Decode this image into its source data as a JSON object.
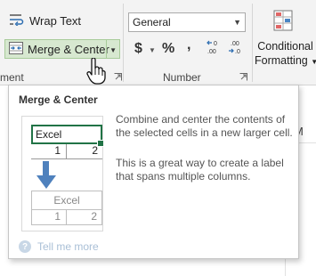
{
  "ribbon": {
    "alignment": {
      "group_label_partial": "ment",
      "wrap_text_label": "Wrap Text",
      "merge_center_label": "Merge & Center"
    },
    "number": {
      "group_label": "Number",
      "format_value": "General",
      "currency_symbol": "$",
      "percent_symbol": "%",
      "comma_symbol": ","
    },
    "styles": {
      "conditional_label_line1": "Conditional",
      "conditional_label_line2": "Formatting"
    }
  },
  "grid": {
    "column_header_partial": "M"
  },
  "tooltip": {
    "title": "Merge & Center",
    "description": "Combine and center the contents of the selected cells in a new larger cell.",
    "detail": "This is a great way to create a label that spans multiple columns.",
    "help_link": "Tell me more",
    "illustration": {
      "before_merged_text": "Excel",
      "before_values": [
        "1",
        "2"
      ],
      "after_merged_text": "Excel",
      "after_values": [
        "1",
        "2"
      ]
    }
  },
  "colors": {
    "merge_highlight": "#d7e8d0",
    "selection_green": "#217346",
    "arrow_blue": "#4f81bd",
    "help_link": "#a9bfd6"
  },
  "icons": [
    "wrap-text-icon",
    "merge-center-icon",
    "dropdown-arrow-icon",
    "currency-icon",
    "percent-icon",
    "comma-style-icon",
    "increase-decimal-icon",
    "decrease-decimal-icon",
    "conditional-formatting-icon",
    "dialog-launcher-icon",
    "help-icon",
    "mouse-pointer-icon"
  ]
}
